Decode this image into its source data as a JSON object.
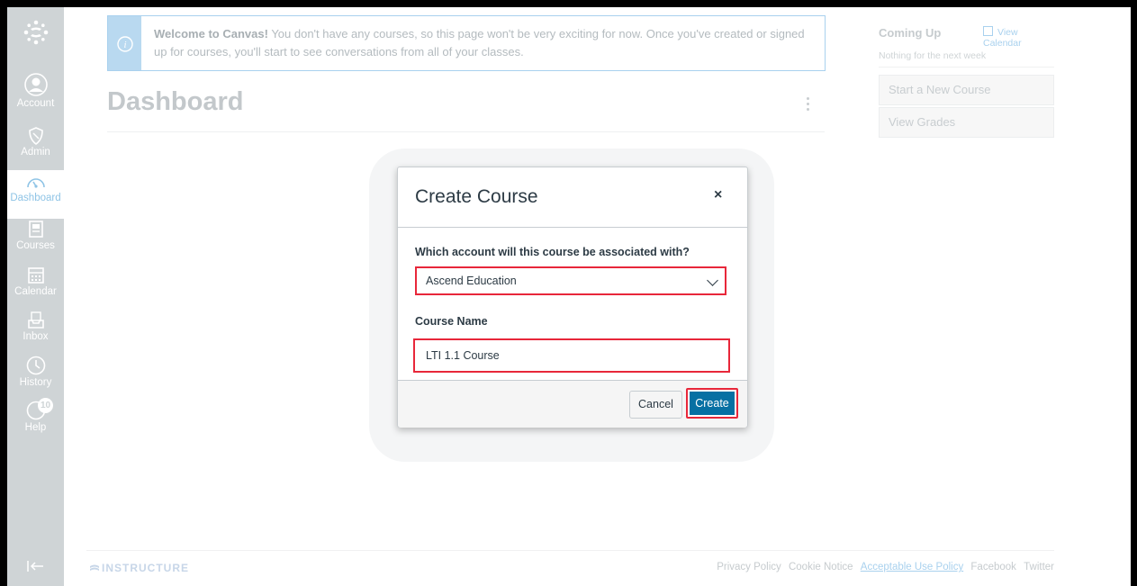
{
  "sidebar": {
    "items": [
      {
        "label": "Account",
        "icon": "account-icon"
      },
      {
        "label": "Admin",
        "icon": "admin-icon"
      },
      {
        "label": "Dashboard",
        "icon": "dashboard-icon",
        "active": true
      },
      {
        "label": "Courses",
        "icon": "courses-icon"
      },
      {
        "label": "Calendar",
        "icon": "calendar-icon"
      },
      {
        "label": "Inbox",
        "icon": "inbox-icon"
      },
      {
        "label": "History",
        "icon": "history-icon"
      },
      {
        "label": "Help",
        "icon": "help-icon",
        "badge": "10"
      }
    ]
  },
  "alert": {
    "bold": "Welcome to Canvas!",
    "text": "You don't have any courses, so this page won't be very exciting for now. Once you've created or signed up for courses, you'll start to see conversations from all of your classes."
  },
  "dashboard": {
    "title": "Dashboard"
  },
  "right_column": {
    "heading": "Coming Up",
    "view_calendar": "View Calendar",
    "nothing": "Nothing for the next week",
    "start_course": "Start a New Course",
    "view_grades": "View Grades"
  },
  "footer": {
    "brand": "INSTRUCTURE",
    "links": [
      "Privacy Policy",
      "Cookie Notice",
      "Acceptable Use Policy",
      "Facebook",
      "Twitter"
    ]
  },
  "modal": {
    "title": "Create Course",
    "close": "×",
    "account_label": "Which account will this course be associated with?",
    "account_value": "Ascend Education",
    "course_name_label": "Course Name",
    "course_name_value": "LTI 1.1 Course",
    "cancel": "Cancel",
    "create": "Create"
  },
  "colors": {
    "sidebar": "#cfd4d6",
    "primary_button": "#0770a3",
    "highlight": "#e8273a"
  }
}
